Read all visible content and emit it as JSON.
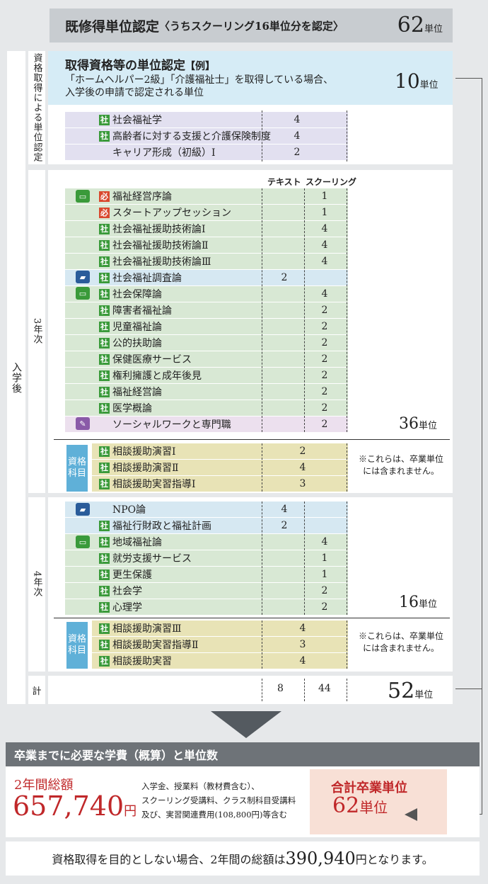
{
  "header": {
    "title": "既修得単位認定",
    "sub": "〈うちスクーリング16単位分を認定〉",
    "total": "62",
    "unit": "単位"
  },
  "left_label": "入学後",
  "cert": {
    "side": "資格取得による単位認定",
    "title": "取得資格等の単位認定",
    "tag": "【例】",
    "desc1": "「ホームヘルパー2級」「介護福祉士」を取得している場合、",
    "desc2": "入学後の申請で認定される単位",
    "total": "10",
    "rows": [
      {
        "tag": "社",
        "name": "社会福祉学",
        "credit": "4"
      },
      {
        "tag": "社",
        "name": "高齢者に対する支援と介護保険制度",
        "credit": "4"
      },
      {
        "tag": "",
        "name": "キャリア形成（初級）Ⅰ",
        "credit": "2"
      }
    ]
  },
  "col_headers": {
    "text": "テキスト",
    "schooling": "スクーリング"
  },
  "year3": {
    "label": "3年次",
    "rows": [
      {
        "tag": "必",
        "name": "福祉経営序論",
        "text": "",
        "sch": "1"
      },
      {
        "tag": "必",
        "name": "スタートアップセッション",
        "text": "",
        "sch": "1"
      },
      {
        "tag": "社",
        "name": "社会福祉援助技術論Ⅰ",
        "text": "",
        "sch": "4"
      },
      {
        "tag": "社",
        "name": "社会福祉援助技術論Ⅱ",
        "text": "",
        "sch": "4"
      },
      {
        "tag": "社",
        "name": "社会福祉援助技術論Ⅲ",
        "text": "",
        "sch": "4"
      },
      {
        "tag": "社",
        "name": "社会福祉調査論",
        "text": "2",
        "sch": ""
      },
      {
        "tag": "社",
        "name": "社会保障論",
        "text": "",
        "sch": "4"
      },
      {
        "tag": "社",
        "name": "障害者福祉論",
        "text": "",
        "sch": "2"
      },
      {
        "tag": "社",
        "name": "児童福祉論",
        "text": "",
        "sch": "2"
      },
      {
        "tag": "社",
        "name": "公的扶助論",
        "text": "",
        "sch": "2"
      },
      {
        "tag": "社",
        "name": "保健医療サービス",
        "text": "",
        "sch": "2"
      },
      {
        "tag": "社",
        "name": "権利擁護と成年後見",
        "text": "",
        "sch": "2"
      },
      {
        "tag": "社",
        "name": "福祉経営論",
        "text": "",
        "sch": "2"
      },
      {
        "tag": "社",
        "name": "医学概論",
        "text": "",
        "sch": "2"
      },
      {
        "tag": "",
        "name": "ソーシャルワークと専門職",
        "text": "",
        "sch": "2"
      }
    ],
    "total": "36",
    "shikaku": "資格科目",
    "qual_rows": [
      {
        "tag": "社",
        "name": "相談援助演習Ⅰ",
        "credit": "2"
      },
      {
        "tag": "社",
        "name": "相談援助演習Ⅱ",
        "credit": "4"
      },
      {
        "tag": "社",
        "name": "相談援助実習指導Ⅰ",
        "credit": "3"
      }
    ],
    "note1": "※これらは、卒業単位",
    "note2": "には含まれません。"
  },
  "year4": {
    "label": "4年次",
    "rows": [
      {
        "tag": "",
        "name": "NPO論",
        "text": "4",
        "sch": ""
      },
      {
        "tag": "社",
        "name": "福祉行財政と福祉計画",
        "text": "2",
        "sch": ""
      },
      {
        "tag": "社",
        "name": "地域福祉論",
        "text": "",
        "sch": "4"
      },
      {
        "tag": "社",
        "name": "就労支援サービス",
        "text": "",
        "sch": "1"
      },
      {
        "tag": "社",
        "name": "更生保護",
        "text": "",
        "sch": "1"
      },
      {
        "tag": "社",
        "name": "社会学",
        "text": "",
        "sch": "2"
      },
      {
        "tag": "社",
        "name": "心理学",
        "text": "",
        "sch": "2"
      }
    ],
    "total": "16",
    "shikaku": "資格科目",
    "qual_rows": [
      {
        "tag": "社",
        "name": "相談援助演習Ⅲ",
        "credit": "4"
      },
      {
        "tag": "社",
        "name": "相談援助実習指導Ⅱ",
        "credit": "3"
      },
      {
        "tag": "社",
        "name": "相談援助実習",
        "credit": "4"
      }
    ],
    "note1": "※これらは、卒業単位",
    "note2": "には含まれません。"
  },
  "sum": {
    "label": "計",
    "text": "8",
    "sch": "44",
    "total": "52"
  },
  "fees": {
    "heading": "卒業までに必要な学費（概算）と単位数",
    "label": "2年間総額",
    "amount": "657,740",
    "yen": "円",
    "desc1": "入学金、授業料（教材費含む）、",
    "desc2": "スクーリング受講料、クラス制科目受講料",
    "desc3": "及び、実習関連費用(108,800円)等含む",
    "grad_label": "合計卒業単位",
    "grad_total": "62",
    "grad_unit": "単位",
    "footer_pre": "資格取得を目的としない場合、2年間の総額は",
    "footer_amount": "390,940",
    "footer_post": "円となります。"
  }
}
